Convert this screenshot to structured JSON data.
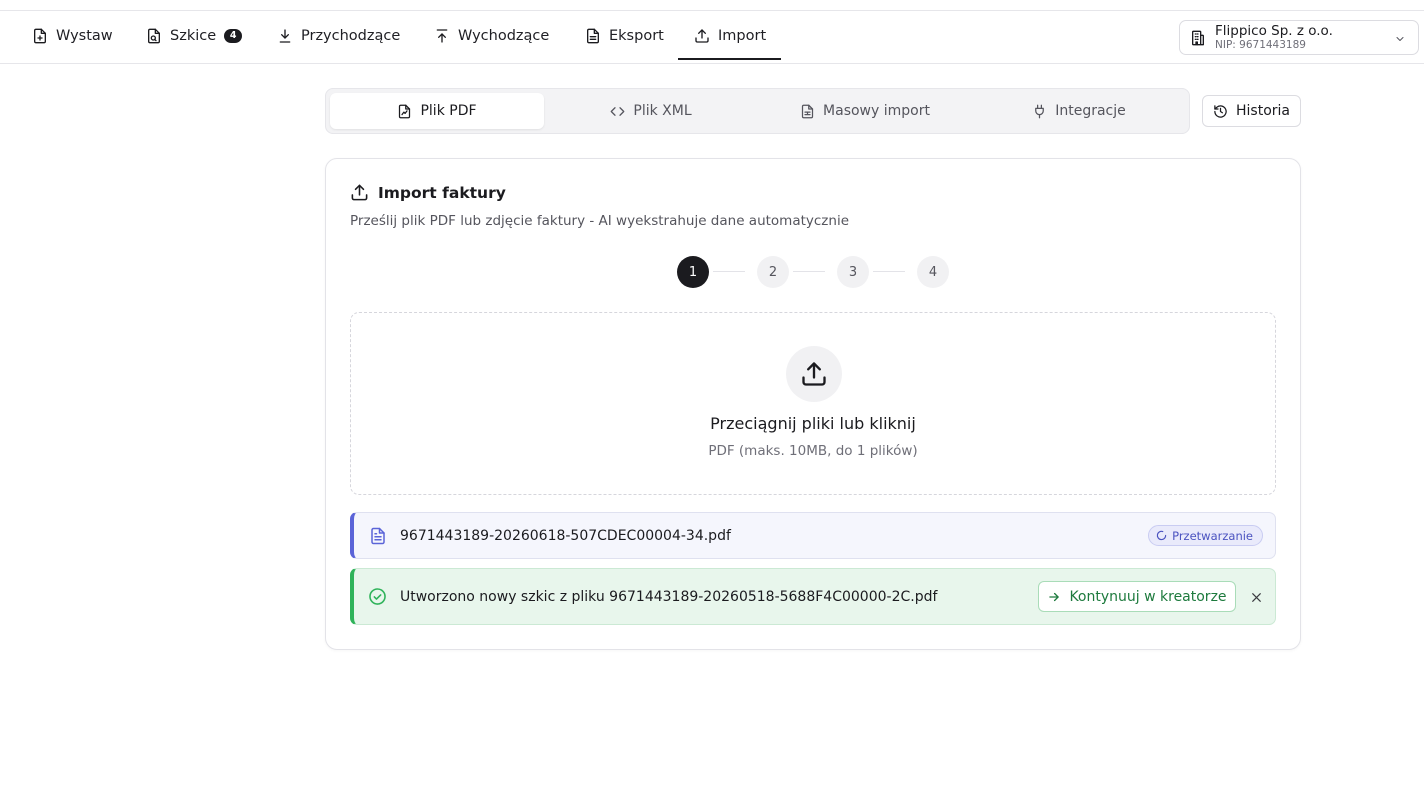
{
  "nav": {
    "items": [
      {
        "label": "Wystaw",
        "icon": "file-plus-icon"
      },
      {
        "label": "Szkice",
        "icon": "drafts-icon",
        "badge": "4"
      },
      {
        "label": "Przychodzące",
        "icon": "download-icon"
      },
      {
        "label": "Wychodzące",
        "icon": "upload-icon"
      },
      {
        "label": "Eksport",
        "icon": "file-text-icon"
      },
      {
        "label": "Import",
        "icon": "upload-icon",
        "active": true
      }
    ]
  },
  "company": {
    "name": "Flippico Sp. z o.o.",
    "nip": "NIP: 9671443189",
    "icon": "building-icon"
  },
  "tabs": [
    {
      "label": "Plik PDF",
      "icon": "file-pdf-icon",
      "active": true
    },
    {
      "label": "Plik XML",
      "icon": "code-icon"
    },
    {
      "label": "Masowy import",
      "icon": "file-spreadsheet-icon"
    },
    {
      "label": "Integracje",
      "icon": "plug-icon"
    }
  ],
  "historia": {
    "label": "Historia",
    "icon": "history-icon"
  },
  "card": {
    "title": "Import faktury",
    "subtitle": "Prześlij plik PDF lub zdjęcie faktury - AI wyekstrahuje dane automatycznie",
    "steps": [
      "1",
      "2",
      "3",
      "4"
    ],
    "active_step": "1",
    "dropzone": {
      "title": "Przeciągnij pliki lub kliknij",
      "hint": "PDF (maks. 10MB, do 1 plików)"
    },
    "file": {
      "name": "9671443189-20260618-507CDEC00004-34.pdf",
      "status": "Przetwarzanie"
    },
    "success": {
      "message": "Utworzono nowy szkic z pliku 9671443189-20260518-5688F4C00000-2C.pdf",
      "continue_label": "Kontynuuj w kreatorze"
    }
  },
  "colors": {
    "accent": "#1b1b1f",
    "processing": "#5b64d8",
    "success": "#2fb35a"
  }
}
